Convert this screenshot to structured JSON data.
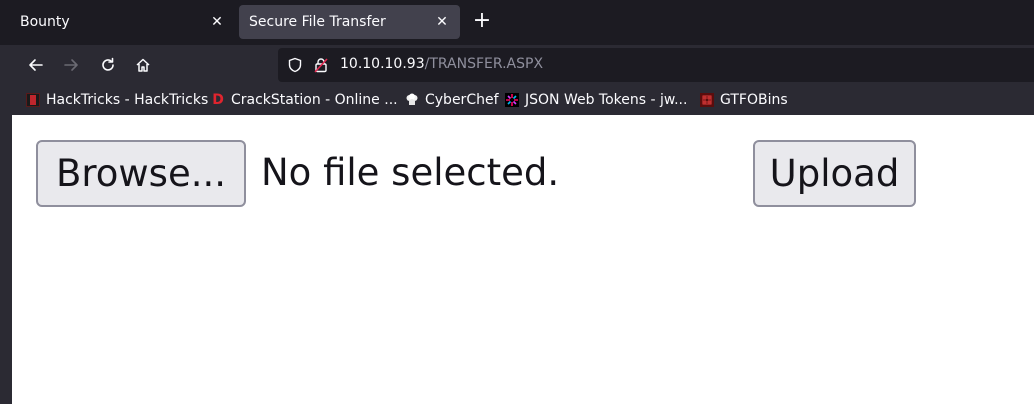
{
  "tabs": [
    {
      "title": "Bounty",
      "active": false
    },
    {
      "title": "Secure File Transfer",
      "active": true
    }
  ],
  "navbar": {
    "url_host": "10.10.10.93",
    "url_path": "/TRANSFER.ASPX"
  },
  "bookmarks": [
    {
      "label": "HackTricks - HackTricks",
      "icon": "hacktricks-icon"
    },
    {
      "label": "CrackStation - Online ...",
      "icon": "crackstation-icon"
    },
    {
      "label": "CyberChef",
      "icon": "cyberchef-icon"
    },
    {
      "label": "JSON Web Tokens - jw...",
      "icon": "jwt-icon"
    },
    {
      "label": "GTFOBins",
      "icon": "gtfobins-icon"
    }
  ],
  "form": {
    "browse_label": "Browse...",
    "file_status": "No file selected.",
    "upload_label": "Upload"
  },
  "colors": {
    "tabbar_bg": "#1c1b22",
    "toolbar_bg": "#2b2a33",
    "active_tab_bg": "#42414d",
    "button_bg": "#e9e9ed",
    "button_border": "#8f8f9d"
  }
}
